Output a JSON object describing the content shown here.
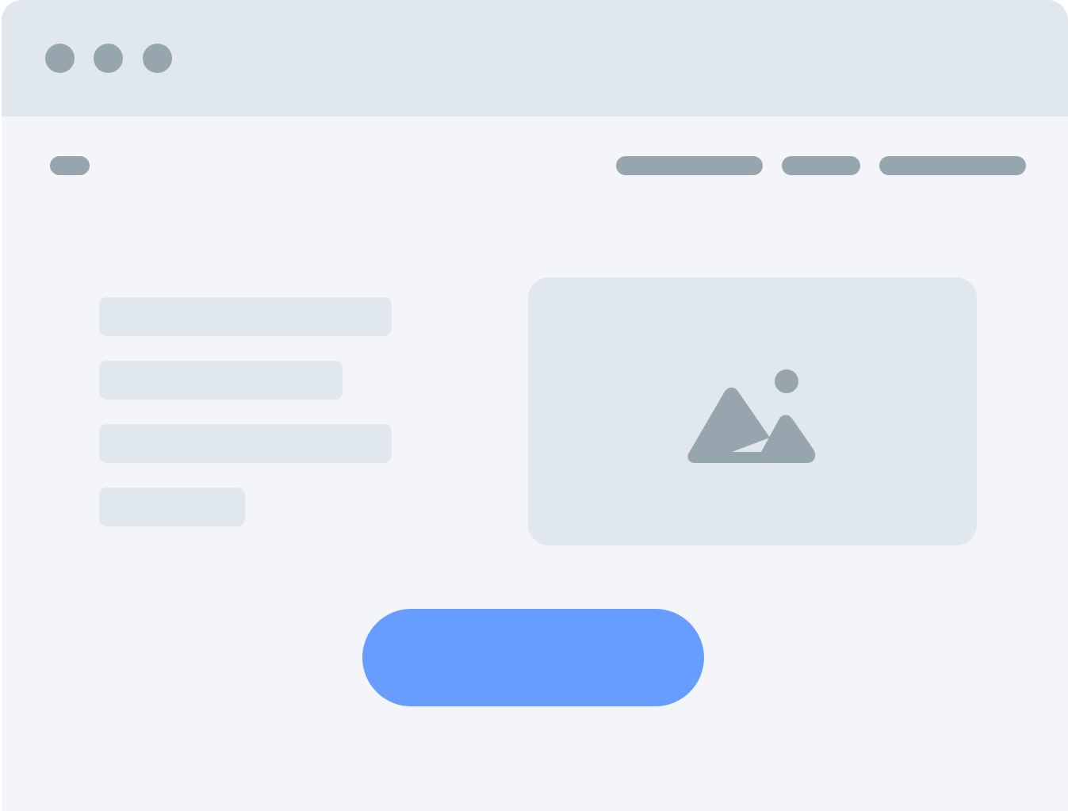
{
  "window": {
    "background": "#F3F5F8",
    "titlebar_color": "#E0E7ED",
    "controls": [
      "window-dot",
      "window-dot",
      "window-dot"
    ],
    "control_color": "#97A5AE"
  },
  "header": {
    "logo_placeholder_color": "#97A5AE",
    "nav_items": [
      "nav-placeholder",
      "nav-placeholder",
      "nav-placeholder"
    ]
  },
  "hero": {
    "text_lines": [
      "text-placeholder",
      "text-placeholder",
      "text-placeholder",
      "text-placeholder"
    ],
    "text_line_color": "#E0E7ED",
    "image": {
      "icon": "image-icon",
      "background": "#E0E7ED",
      "icon_color": "#97A5AE"
    },
    "cta": {
      "label": "",
      "color": "#669DFF"
    }
  }
}
